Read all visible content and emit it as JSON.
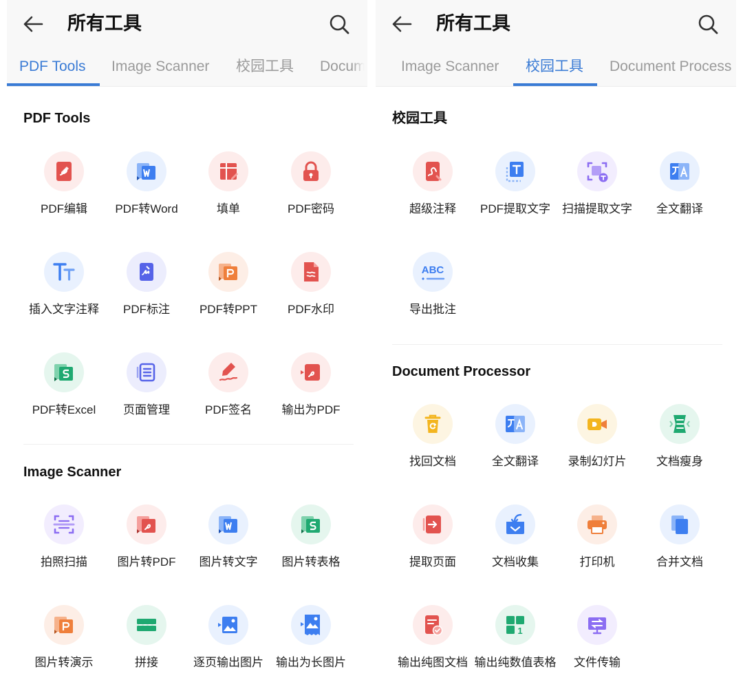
{
  "left": {
    "header": {
      "title": "所有工具"
    },
    "tabs": [
      {
        "label": "PDF Tools"
      },
      {
        "label": "Image Scanner"
      },
      {
        "label": "校园工具"
      },
      {
        "label": "Docum"
      }
    ],
    "sections": [
      {
        "title": "PDF Tools",
        "tools": [
          {
            "label": "PDF编辑",
            "icon": "pdf-edit-icon"
          },
          {
            "label": "PDF转Word",
            "icon": "pdf-to-word-icon"
          },
          {
            "label": "填单",
            "icon": "fill-form-icon"
          },
          {
            "label": "PDF密码",
            "icon": "lock-icon"
          },
          {
            "label": "插入文字注释",
            "icon": "text-annotation-icon"
          },
          {
            "label": "PDF标注",
            "icon": "pdf-markup-icon"
          },
          {
            "label": "PDF转PPT",
            "icon": "pdf-to-ppt-icon"
          },
          {
            "label": "PDF水印",
            "icon": "watermark-icon"
          },
          {
            "label": "PDF转Excel",
            "icon": "pdf-to-excel-icon"
          },
          {
            "label": "页面管理",
            "icon": "page-manage-icon"
          },
          {
            "label": "PDF签名",
            "icon": "signature-icon"
          },
          {
            "label": "输出为PDF",
            "icon": "export-pdf-icon"
          }
        ]
      },
      {
        "title": "Image Scanner",
        "tools": [
          {
            "label": "拍照扫描",
            "icon": "scan-icon"
          },
          {
            "label": "图片转PDF",
            "icon": "image-to-pdf-icon"
          },
          {
            "label": "图片转文字",
            "icon": "image-to-text-icon"
          },
          {
            "label": "图片转表格",
            "icon": "image-to-table-icon"
          },
          {
            "label": "图片转演示",
            "icon": "image-to-slides-icon"
          },
          {
            "label": "拼接",
            "icon": "stitch-icon"
          },
          {
            "label": "逐页输出图片",
            "icon": "export-images-icon"
          },
          {
            "label": "输出为长图片",
            "icon": "long-image-icon"
          }
        ]
      }
    ]
  },
  "right": {
    "header": {
      "title": "所有工具"
    },
    "tabs": [
      {
        "label": "Image Scanner"
      },
      {
        "label": "校园工具"
      },
      {
        "label": "Document Process"
      }
    ],
    "sections": [
      {
        "title": "校园工具",
        "tools": [
          {
            "label": "超级注释",
            "icon": "super-annotation-icon"
          },
          {
            "label": "PDF提取文字",
            "icon": "pdf-extract-text-icon"
          },
          {
            "label": "扫描提取文字",
            "icon": "scan-extract-text-icon"
          },
          {
            "label": "全文翻译",
            "icon": "translate-icon"
          },
          {
            "label": "导出批注",
            "icon": "export-annotations-icon"
          }
        ]
      },
      {
        "title": "Document Processor",
        "tools": [
          {
            "label": "找回文档",
            "icon": "recover-doc-icon"
          },
          {
            "label": "全文翻译",
            "icon": "translate-icon"
          },
          {
            "label": "录制幻灯片",
            "icon": "record-slides-icon"
          },
          {
            "label": "文档瘦身",
            "icon": "compress-doc-icon"
          },
          {
            "label": "提取页面",
            "icon": "extract-pages-icon"
          },
          {
            "label": "文档收集",
            "icon": "collect-docs-icon"
          },
          {
            "label": "打印机",
            "icon": "printer-icon"
          },
          {
            "label": "合并文档",
            "icon": "merge-docs-icon"
          },
          {
            "label": "输出纯图文档",
            "icon": "image-doc-icon"
          },
          {
            "label": "输出纯数值表格",
            "icon": "value-table-icon"
          },
          {
            "label": "文件传输",
            "icon": "file-transfer-icon"
          }
        ]
      }
    ]
  },
  "colors": {
    "accent": "#3a7bd5",
    "red": "#e2534f",
    "blue": "#3d7ef0",
    "green": "#1fa971",
    "orange": "#ef7f3b",
    "purple": "#8b6df2",
    "indigo": "#5663e8",
    "yellow": "#f3b51f"
  }
}
